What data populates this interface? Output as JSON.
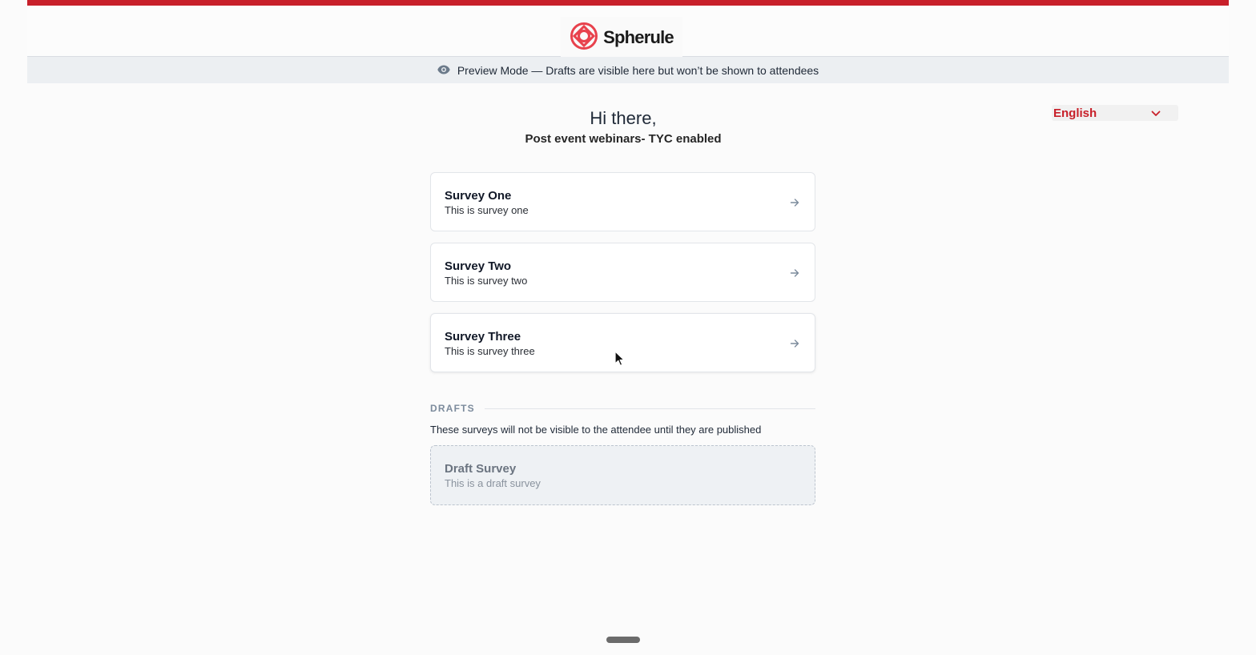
{
  "brand": {
    "name": "Spherule",
    "logo_icon": "spherule-logo-icon",
    "accent_color": "#c8202a",
    "logo_color": "#e8424d"
  },
  "preview_banner": {
    "icon": "eye-icon",
    "text": "Preview Mode — Drafts are visible here but won’t be shown to attendees"
  },
  "language_select": {
    "value": "English",
    "icon": "chevron-down-icon",
    "color": "#c8202a"
  },
  "greeting": "Hi there,",
  "event_title": "Post event webinars- TYC enabled",
  "surveys": [
    {
      "title": "Survey One",
      "description": "This is survey one",
      "icon": "arrow-right-icon"
    },
    {
      "title": "Survey Two",
      "description": "This is survey two",
      "icon": "arrow-right-icon"
    },
    {
      "title": "Survey Three",
      "description": "This is survey three",
      "icon": "arrow-right-icon"
    }
  ],
  "drafts": {
    "label": "DRAFTS",
    "note": "These surveys will not be visible to the attendee until they are published",
    "items": [
      {
        "title": "Draft Survey",
        "description": "This is a draft survey"
      }
    ]
  }
}
